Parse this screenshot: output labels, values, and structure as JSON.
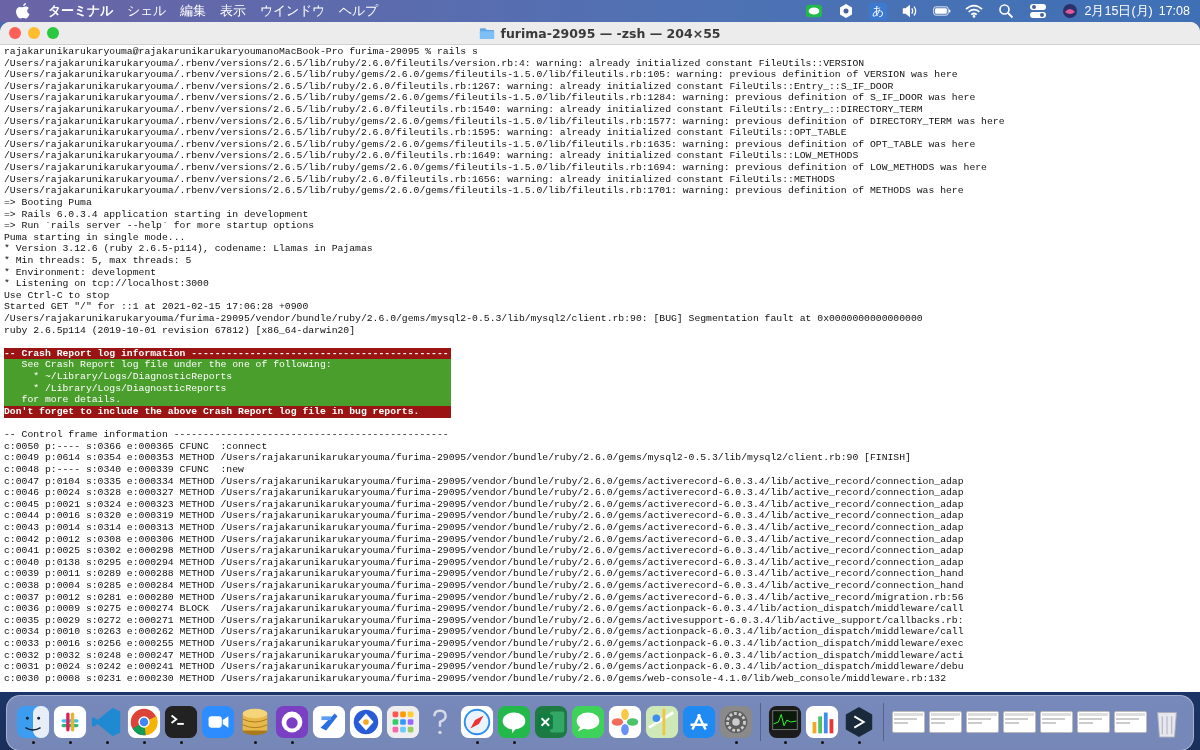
{
  "menubar": {
    "app_name": "ターミナル",
    "menus": [
      "シェル",
      "編集",
      "表示",
      "ウインドウ",
      "ヘルプ"
    ],
    "input_mode": "あ",
    "date": "2月15日(月)",
    "time": "17:08"
  },
  "window": {
    "title": "furima-29095 — -zsh — 204×55"
  },
  "terminal": {
    "lines": [
      {
        "kind": "normal",
        "text": "rajakarunikarukaryouma@rajakarunikarukaryoumanoMacBook-Pro furima-29095 % rails s"
      },
      {
        "kind": "normal",
        "text": "/Users/rajakarunikarukaryouma/.rbenv/versions/2.6.5/lib/ruby/2.6.0/fileutils/version.rb:4: warning: already initialized constant FileUtils::VERSION"
      },
      {
        "kind": "normal",
        "text": "/Users/rajakarunikarukaryouma/.rbenv/versions/2.6.5/lib/ruby/gems/2.6.0/gems/fileutils-1.5.0/lib/fileutils.rb:105: warning: previous definition of VERSION was here"
      },
      {
        "kind": "normal",
        "text": "/Users/rajakarunikarukaryouma/.rbenv/versions/2.6.5/lib/ruby/2.6.0/fileutils.rb:1267: warning: already initialized constant FileUtils::Entry_::S_IF_DOOR"
      },
      {
        "kind": "normal",
        "text": "/Users/rajakarunikarukaryouma/.rbenv/versions/2.6.5/lib/ruby/gems/2.6.0/gems/fileutils-1.5.0/lib/fileutils.rb:1284: warning: previous definition of S_IF_DOOR was here"
      },
      {
        "kind": "normal",
        "text": "/Users/rajakarunikarukaryouma/.rbenv/versions/2.6.5/lib/ruby/2.6.0/fileutils.rb:1540: warning: already initialized constant FileUtils::Entry_::DIRECTORY_TERM"
      },
      {
        "kind": "normal",
        "text": "/Users/rajakarunikarukaryouma/.rbenv/versions/2.6.5/lib/ruby/gems/2.6.0/gems/fileutils-1.5.0/lib/fileutils.rb:1577: warning: previous definition of DIRECTORY_TERM was here"
      },
      {
        "kind": "normal",
        "text": "/Users/rajakarunikarukaryouma/.rbenv/versions/2.6.5/lib/ruby/2.6.0/fileutils.rb:1595: warning: already initialized constant FileUtils::OPT_TABLE"
      },
      {
        "kind": "normal",
        "text": "/Users/rajakarunikarukaryouma/.rbenv/versions/2.6.5/lib/ruby/gems/2.6.0/gems/fileutils-1.5.0/lib/fileutils.rb:1635: warning: previous definition of OPT_TABLE was here"
      },
      {
        "kind": "normal",
        "text": "/Users/rajakarunikarukaryouma/.rbenv/versions/2.6.5/lib/ruby/2.6.0/fileutils.rb:1649: warning: already initialized constant FileUtils::LOW_METHODS"
      },
      {
        "kind": "normal",
        "text": "/Users/rajakarunikarukaryouma/.rbenv/versions/2.6.5/lib/ruby/gems/2.6.0/gems/fileutils-1.5.0/lib/fileutils.rb:1694: warning: previous definition of LOW_METHODS was here"
      },
      {
        "kind": "normal",
        "text": "/Users/rajakarunikarukaryouma/.rbenv/versions/2.6.5/lib/ruby/2.6.0/fileutils.rb:1656: warning: already initialized constant FileUtils::METHODS"
      },
      {
        "kind": "normal",
        "text": "/Users/rajakarunikarukaryouma/.rbenv/versions/2.6.5/lib/ruby/gems/2.6.0/gems/fileutils-1.5.0/lib/fileutils.rb:1701: warning: previous definition of METHODS was here"
      },
      {
        "kind": "normal",
        "text": "=> Booting Puma"
      },
      {
        "kind": "normal",
        "text": "=> Rails 6.0.3.4 application starting in development"
      },
      {
        "kind": "normal",
        "text": "=> Run `rails server --help` for more startup options"
      },
      {
        "kind": "normal",
        "text": "Puma starting in single mode..."
      },
      {
        "kind": "normal",
        "text": "* Version 3.12.6 (ruby 2.6.5-p114), codename: Llamas in Pajamas"
      },
      {
        "kind": "normal",
        "text": "* Min threads: 5, max threads: 5"
      },
      {
        "kind": "normal",
        "text": "* Environment: development"
      },
      {
        "kind": "normal",
        "text": "* Listening on tcp://localhost:3000"
      },
      {
        "kind": "normal",
        "text": "Use Ctrl-C to stop"
      },
      {
        "kind": "normal",
        "text": "Started GET \"/\" for ::1 at 2021-02-15 17:06:28 +0900"
      },
      {
        "kind": "normal",
        "text": "/Users/rajakarunikarukaryouma/furima-29095/vendor/bundle/ruby/2.6.0/gems/mysql2-0.5.3/lib/mysql2/client.rb:90: [BUG] Segmentation fault at 0x0000000000000000"
      },
      {
        "kind": "normal",
        "text": "ruby 2.6.5p114 (2019-10-01 revision 67812) [x86_64-darwin20]"
      },
      {
        "kind": "blank"
      },
      {
        "kind": "alert",
        "text": "-- Crash Report log information --------------------------------------------"
      },
      {
        "kind": "note",
        "text": "   See Crash Report log file under the one of following:"
      },
      {
        "kind": "note",
        "text": "     * ~/Library/Logs/DiagnosticReports"
      },
      {
        "kind": "note",
        "text": "     * /Library/Logs/DiagnosticReports"
      },
      {
        "kind": "note",
        "text": "   for more details."
      },
      {
        "kind": "alert",
        "text": "Don't forget to include the above Crash Report log file in bug reports."
      },
      {
        "kind": "blank"
      },
      {
        "kind": "normal",
        "text": "-- Control frame information -----------------------------------------------"
      },
      {
        "kind": "normal",
        "text": "c:0050 p:---- s:0366 e:000365 CFUNC  :connect"
      },
      {
        "kind": "normal",
        "text": "c:0049 p:0614 s:0354 e:000353 METHOD /Users/rajakarunikarukaryouma/furima-29095/vendor/bundle/ruby/2.6.0/gems/mysql2-0.5.3/lib/mysql2/client.rb:90 [FINISH]"
      },
      {
        "kind": "normal",
        "text": "c:0048 p:---- s:0340 e:000339 CFUNC  :new"
      },
      {
        "kind": "normal",
        "text": "c:0047 p:0104 s:0335 e:000334 METHOD /Users/rajakarunikarukaryouma/furima-29095/vendor/bundle/ruby/2.6.0/gems/activerecord-6.0.3.4/lib/active_record/connection_adap"
      },
      {
        "kind": "normal",
        "text": "c:0046 p:0024 s:0328 e:000327 METHOD /Users/rajakarunikarukaryouma/furima-29095/vendor/bundle/ruby/2.6.0/gems/activerecord-6.0.3.4/lib/active_record/connection_adap"
      },
      {
        "kind": "normal",
        "text": "c:0045 p:0021 s:0324 e:000323 METHOD /Users/rajakarunikarukaryouma/furima-29095/vendor/bundle/ruby/2.6.0/gems/activerecord-6.0.3.4/lib/active_record/connection_adap"
      },
      {
        "kind": "normal",
        "text": "c:0044 p:0016 s:0320 e:000319 METHOD /Users/rajakarunikarukaryouma/furima-29095/vendor/bundle/ruby/2.6.0/gems/activerecord-6.0.3.4/lib/active_record/connection_adap"
      },
      {
        "kind": "normal",
        "text": "c:0043 p:0014 s:0314 e:000313 METHOD /Users/rajakarunikarukaryouma/furima-29095/vendor/bundle/ruby/2.6.0/gems/activerecord-6.0.3.4/lib/active_record/connection_adap"
      },
      {
        "kind": "normal",
        "text": "c:0042 p:0012 s:0308 e:000306 METHOD /Users/rajakarunikarukaryouma/furima-29095/vendor/bundle/ruby/2.6.0/gems/activerecord-6.0.3.4/lib/active_record/connection_adap"
      },
      {
        "kind": "normal",
        "text": "c:0041 p:0025 s:0302 e:000298 METHOD /Users/rajakarunikarukaryouma/furima-29095/vendor/bundle/ruby/2.6.0/gems/activerecord-6.0.3.4/lib/active_record/connection_adap"
      },
      {
        "kind": "normal",
        "text": "c:0040 p:0138 s:0295 e:000294 METHOD /Users/rajakarunikarukaryouma/furima-29095/vendor/bundle/ruby/2.6.0/gems/activerecord-6.0.3.4/lib/active_record/connection_adap"
      },
      {
        "kind": "normal",
        "text": "c:0039 p:0011 s:0289 e:000288 METHOD /Users/rajakarunikarukaryouma/furima-29095/vendor/bundle/ruby/2.6.0/gems/activerecord-6.0.3.4/lib/active_record/connection_hand"
      },
      {
        "kind": "normal",
        "text": "c:0038 p:0004 s:0285 e:000284 METHOD /Users/rajakarunikarukaryouma/furima-29095/vendor/bundle/ruby/2.6.0/gems/activerecord-6.0.3.4/lib/active_record/connection_hand"
      },
      {
        "kind": "normal",
        "text": "c:0037 p:0012 s:0281 e:000280 METHOD /Users/rajakarunikarukaryouma/furima-29095/vendor/bundle/ruby/2.6.0/gems/activerecord-6.0.3.4/lib/active_record/migration.rb:56"
      },
      {
        "kind": "normal",
        "text": "c:0036 p:0009 s:0275 e:000274 BLOCK  /Users/rajakarunikarukaryouma/furima-29095/vendor/bundle/ruby/2.6.0/gems/actionpack-6.0.3.4/lib/action_dispatch/middleware/call"
      },
      {
        "kind": "normal",
        "text": "c:0035 p:0029 s:0272 e:000271 METHOD /Users/rajakarunikarukaryouma/furima-29095/vendor/bundle/ruby/2.6.0/gems/activesupport-6.0.3.4/lib/active_support/callbacks.rb:"
      },
      {
        "kind": "normal",
        "text": "c:0034 p:0010 s:0263 e:000262 METHOD /Users/rajakarunikarukaryouma/furima-29095/vendor/bundle/ruby/2.6.0/gems/actionpack-6.0.3.4/lib/action_dispatch/middleware/call"
      },
      {
        "kind": "normal",
        "text": "c:0033 p:0016 s:0256 e:000255 METHOD /Users/rajakarunikarukaryouma/furima-29095/vendor/bundle/ruby/2.6.0/gems/actionpack-6.0.3.4/lib/action_dispatch/middleware/exec"
      },
      {
        "kind": "normal",
        "text": "c:0032 p:0032 s:0248 e:000247 METHOD /Users/rajakarunikarukaryouma/furima-29095/vendor/bundle/ruby/2.6.0/gems/actionpack-6.0.3.4/lib/action_dispatch/middleware/acti"
      },
      {
        "kind": "normal",
        "text": "c:0031 p:0024 s:0242 e:000241 METHOD /Users/rajakarunikarukaryouma/furima-29095/vendor/bundle/ruby/2.6.0/gems/actionpack-6.0.3.4/lib/action_dispatch/middleware/debu"
      },
      {
        "kind": "normal",
        "text": "c:0030 p:0008 s:0231 e:000230 METHOD /Users/rajakarunikarukaryouma/furima-29095/vendor/bundle/ruby/2.6.0/gems/web-console-4.1.0/lib/web_console/middleware.rb:132"
      }
    ]
  },
  "dock": {
    "items": [
      {
        "kind": "finder",
        "running": true
      },
      {
        "kind": "slack",
        "running": true
      },
      {
        "kind": "editor",
        "running": true
      },
      {
        "kind": "browser",
        "running": true
      },
      {
        "kind": "terminal",
        "running": true
      },
      {
        "kind": "video",
        "running": false
      },
      {
        "kind": "database",
        "running": true
      },
      {
        "kind": "github",
        "running": true
      },
      {
        "kind": "bluemark",
        "running": false
      },
      {
        "kind": "bluering",
        "running": false
      },
      {
        "kind": "launchpad",
        "running": false
      },
      {
        "kind": "question",
        "running": false
      },
      {
        "kind": "safari",
        "running": true
      },
      {
        "kind": "line",
        "running": true
      },
      {
        "kind": "excel",
        "running": false
      },
      {
        "kind": "messages",
        "running": false
      },
      {
        "kind": "photos",
        "running": false
      },
      {
        "kind": "maps",
        "running": false
      },
      {
        "kind": "appstore",
        "running": false
      },
      {
        "kind": "settings",
        "running": true
      },
      {
        "kind": "separator"
      },
      {
        "kind": "monitor",
        "running": true
      },
      {
        "kind": "numbers",
        "running": true
      },
      {
        "kind": "share",
        "running": true
      },
      {
        "kind": "separator"
      },
      {
        "kind": "thumbnail"
      },
      {
        "kind": "thumbnail"
      },
      {
        "kind": "thumbnail"
      },
      {
        "kind": "thumbnail"
      },
      {
        "kind": "thumbnail"
      },
      {
        "kind": "thumbnail"
      },
      {
        "kind": "thumbnail"
      },
      {
        "kind": "trash",
        "running": false
      }
    ]
  }
}
